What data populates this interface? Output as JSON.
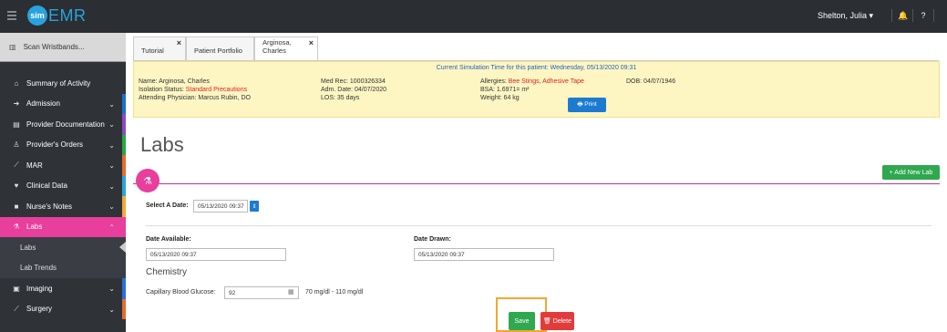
{
  "topbar": {
    "logo_circle": "sim",
    "logo_text": "EMR",
    "user": "Shelton, Julia ▾",
    "bell_icon": "bell-icon",
    "help_icon": "help-icon"
  },
  "sidebar": {
    "scan_label": "Scan Wristbands...",
    "items": [
      {
        "label": "Summary of Activity",
        "icon": "home-icon",
        "stripe": "",
        "chevron": false
      },
      {
        "label": "Admission",
        "icon": "admission-icon",
        "stripe": "#1b6fd1",
        "chevron": true
      },
      {
        "label": "Provider Documentation",
        "icon": "document-icon",
        "stripe": "#8a4bc3",
        "chevron": true
      },
      {
        "label": "Provider's Orders",
        "icon": "orders-icon",
        "stripe": "#27a844",
        "chevron": true
      },
      {
        "label": "MAR",
        "icon": "syringe-icon",
        "stripe": "#e86a2e",
        "chevron": true
      },
      {
        "label": "Clinical Data",
        "icon": "heartbeat-icon",
        "stripe": "#28a7d9",
        "chevron": true
      },
      {
        "label": "Nurse's Notes",
        "icon": "notes-icon",
        "stripe": "#f2a93b",
        "chevron": true
      }
    ],
    "active": {
      "label": "Labs",
      "icon": "flask-icon",
      "stripe": "#e83e9c"
    },
    "sub_items": [
      "Labs",
      "Lab Trends"
    ],
    "after": [
      {
        "label": "Imaging",
        "icon": "image-icon",
        "stripe": "#2b6fdc"
      },
      {
        "label": "Surgery",
        "icon": "scalpel-icon",
        "stripe": "#e86a2e"
      }
    ]
  },
  "tabs": [
    {
      "label": "Tutorial",
      "close": "×"
    },
    {
      "label": "Patient Portfolio",
      "close": ""
    },
    {
      "label": "Arginosa, Charles",
      "close": "×"
    }
  ],
  "banner": {
    "sim_time": "Current Simulation Time for this patient: Wednesday, 05/13/2020 09:31",
    "name": "Name: Arginosa, Charles",
    "isolation_prefix": "Isolation Status: ",
    "isolation_value": "Standard Precautions",
    "attending": "Attending Physician: Marcus Rubin, DO",
    "med_rec": "Med Rec: 1000326334",
    "adm_date": "Adm. Date: 04/07/2020",
    "los": "LOS: 35 days",
    "allergies_prefix": "Allergies: ",
    "allergies_value": "Bee Stings, Adhesive Tape",
    "bsa": "BSA: 1.6971= m²",
    "weight": "Weight: 64 kg",
    "dob": "DOB: 04/07/1946",
    "print_label": "🖶 Print"
  },
  "page_title": "Labs",
  "add_lab_label": "+ Add New Lab",
  "form": {
    "select_date_label": "Select A Date:",
    "select_date_value": "05/13/2020 09:37",
    "date_available_label": "Date Available:",
    "date_available_value": "05/13/2020 09:37",
    "date_drawn_label": "Date Drawn:",
    "date_drawn_value": "05/13/2020 09:37",
    "section_title": "Chemistry",
    "glucose_label": "Capillary Blood Glucose:",
    "glucose_value": "92",
    "glucose_range": "70 mg/dl - 110 mg/dl",
    "save_label": "Save",
    "delete_label": "🗑 Delete"
  },
  "colors": {
    "accent_pink": "#e83e9c",
    "save_green": "#2fa84f",
    "delete_red": "#e23b3b",
    "print_blue": "#1c7bd1",
    "highlight_orange": "#f0a830"
  }
}
